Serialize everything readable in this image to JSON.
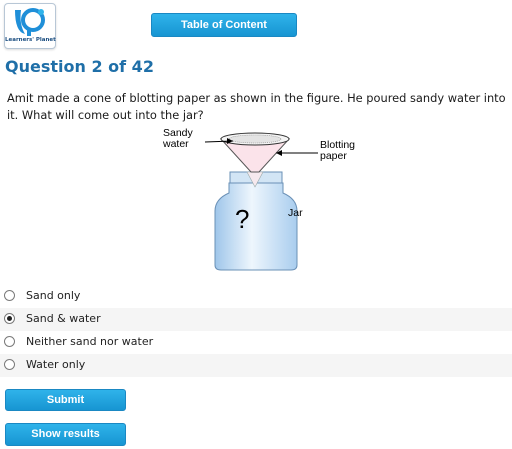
{
  "header": {
    "logo_text": "Learners' Planet",
    "toc_button": "Table of Content"
  },
  "question": {
    "title": "Question 2 of 42",
    "text": "Amit made a cone of blotting paper as shown in the figure. He poured sandy water into it. What will come out into the jar?"
  },
  "figure": {
    "label_sandy": "Sandy\nwater",
    "label_blotting": "Blotting\npaper",
    "label_jar": "Jar",
    "jar_mark": "?"
  },
  "options": [
    {
      "label": "Sand only",
      "selected": false
    },
    {
      "label": "Sand & water",
      "selected": true
    },
    {
      "label": "Neither sand nor water",
      "selected": false
    },
    {
      "label": "Water only",
      "selected": false
    }
  ],
  "actions": {
    "submit": "Submit",
    "show_results": "Show results"
  },
  "colors": {
    "accent": "#1795d2",
    "title": "#1f6fa8"
  }
}
